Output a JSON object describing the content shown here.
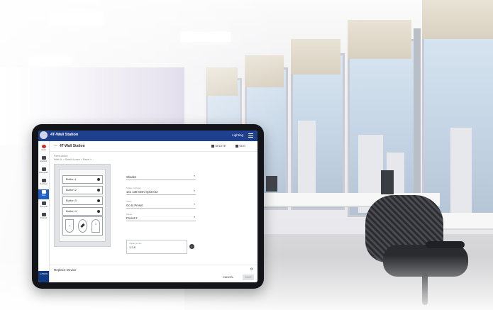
{
  "app": {
    "title": "4T-Wall Station",
    "header_right": "Lighting"
  },
  "sidebar": {
    "items": [
      {
        "label": "Alerts",
        "icon": "alert-icon"
      },
      {
        "label": "Explorer",
        "icon": "send-icon"
      },
      {
        "label": "Dashboard",
        "icon": "dashboard-icon"
      },
      {
        "label": "Overview",
        "icon": "list-icon"
      },
      {
        "label": "Sites",
        "icon": "sites-icon"
      },
      {
        "label": "Schedule",
        "icon": "calendar-icon"
      },
      {
        "label": "Devices",
        "icon": "pin-icon"
      }
    ],
    "footer": "LUTRON"
  },
  "page": {
    "title": "4T-Wall Station",
    "delete_label": "DELETE",
    "edit_label": "EDIT",
    "breadcrumb_label": "Parent device",
    "breadcrumb": "Wall 4L > Small 4-zone > Panel > ..."
  },
  "device": {
    "buttons": [
      "Button 1",
      "Button 2",
      "Button 3",
      "Button 4"
    ]
  },
  "form": {
    "fields": [
      {
        "label": "",
        "value": "Shades"
      },
      {
        "label": "Shade controller",
        "value": "141 136 Metro QS2AS2"
      },
      {
        "label": "Action",
        "value": "Go to Preset"
      },
      {
        "label": "Preset",
        "value": "Preset 2"
      }
    ],
    "textarea_label": "Shade groups",
    "textarea_value": "1,2,8"
  },
  "footer": {
    "replace_label": "Replace Device",
    "cancel_label": "CANCEL",
    "save_label": "SAVE"
  }
}
